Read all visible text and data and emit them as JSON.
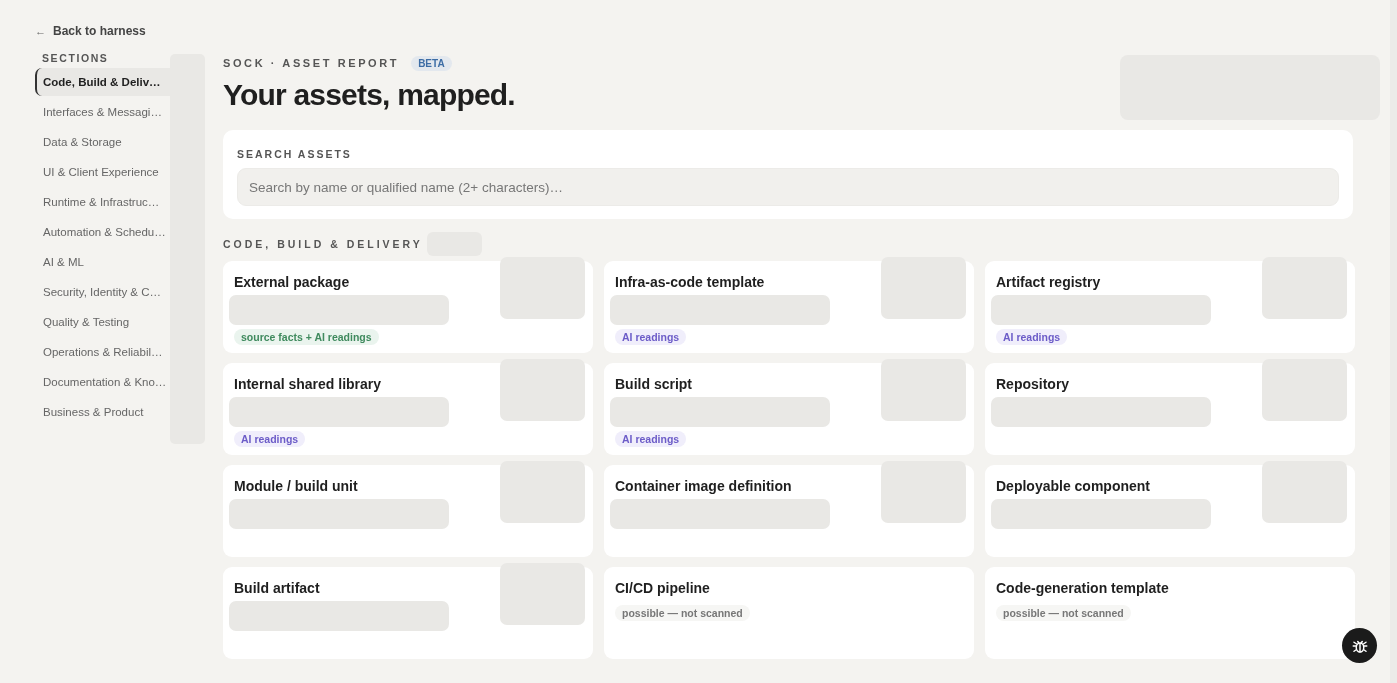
{
  "back_link": {
    "icon": "←",
    "label": "Back to harness"
  },
  "sidebar": {
    "heading": "SECTIONS",
    "items": [
      {
        "label": "Code, Build & Deliv…",
        "selected": true
      },
      {
        "label": "Interfaces & Messagi…",
        "selected": false
      },
      {
        "label": "Data & Storage",
        "selected": false
      },
      {
        "label": "UI & Client Experience",
        "selected": false
      },
      {
        "label": "Runtime & Infrastruc…",
        "selected": false
      },
      {
        "label": "Automation & Schedu…",
        "selected": false
      },
      {
        "label": "AI & ML",
        "selected": false
      },
      {
        "label": "Security, Identity & C…",
        "selected": false
      },
      {
        "label": "Quality & Testing",
        "selected": false
      },
      {
        "label": "Operations & Reliabil…",
        "selected": false
      },
      {
        "label": "Documentation & Kno…",
        "selected": false
      },
      {
        "label": "Business & Product",
        "selected": false
      }
    ]
  },
  "header": {
    "eyebrow": "SOCK · ASSET REPORT",
    "badge": "BETA",
    "title": "Your assets, mapped."
  },
  "search": {
    "label": "SEARCH ASSETS",
    "placeholder": "Search by name or qualified name (2+ characters)…"
  },
  "section": {
    "title": "CODE, BUILD & DELIVERY",
    "cards": [
      {
        "title": "External package",
        "loading": true,
        "tag": {
          "kind": "source",
          "label": "source facts + AI readings"
        }
      },
      {
        "title": "Infra-as-code template",
        "loading": true,
        "tag": {
          "kind": "ai",
          "label": "AI readings"
        }
      },
      {
        "title": "Artifact registry",
        "loading": true,
        "tag": {
          "kind": "ai",
          "label": "AI readings"
        }
      },
      {
        "title": "Internal shared library",
        "loading": true,
        "tag": {
          "kind": "ai",
          "label": "AI readings"
        }
      },
      {
        "title": "Build script",
        "loading": true,
        "tag": {
          "kind": "ai",
          "label": "AI readings"
        }
      },
      {
        "title": "Repository",
        "loading": true
      },
      {
        "title": "Module / build unit",
        "loading": true
      },
      {
        "title": "Container image definition",
        "loading": true
      },
      {
        "title": "Deployable component",
        "loading": true
      },
      {
        "title": "Build artifact",
        "loading": true
      },
      {
        "title": "CI/CD pipeline",
        "loading": false,
        "tag": {
          "kind": "possible",
          "label": "possible — not scanned"
        }
      },
      {
        "title": "Code-generation template",
        "loading": false,
        "tag": {
          "kind": "possible",
          "label": "possible — not scanned"
        }
      }
    ]
  }
}
